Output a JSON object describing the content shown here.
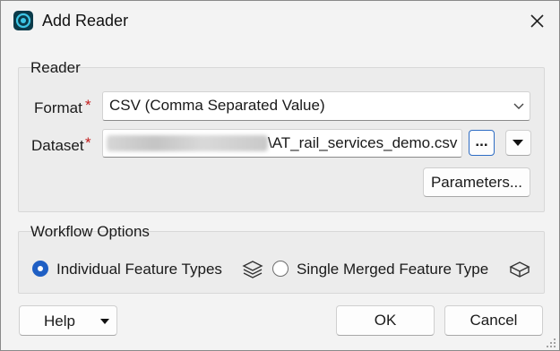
{
  "window": {
    "title": "Add Reader",
    "icon": "fme-app-icon",
    "close_icon": "close-icon"
  },
  "reader": {
    "group_title": "Reader",
    "format_label": "Format",
    "format_required": "*",
    "format_value": "CSV (Comma Separated Value)",
    "dataset_label": "Dataset",
    "dataset_required": "*",
    "dataset_value": "\\AT_rail_services_demo.csv",
    "browse_label": "...",
    "parameters_label": "Parameters..."
  },
  "workflow": {
    "group_title": "Workflow Options",
    "option_individual": "Individual Feature Types",
    "option_merged": "Single Merged Feature Type",
    "selected": "Individual Feature Types"
  },
  "footer": {
    "help_label": "Help",
    "ok_label": "OK",
    "cancel_label": "Cancel"
  },
  "colors": {
    "accent": "#1f5fc4",
    "required": "#c21c1c"
  }
}
